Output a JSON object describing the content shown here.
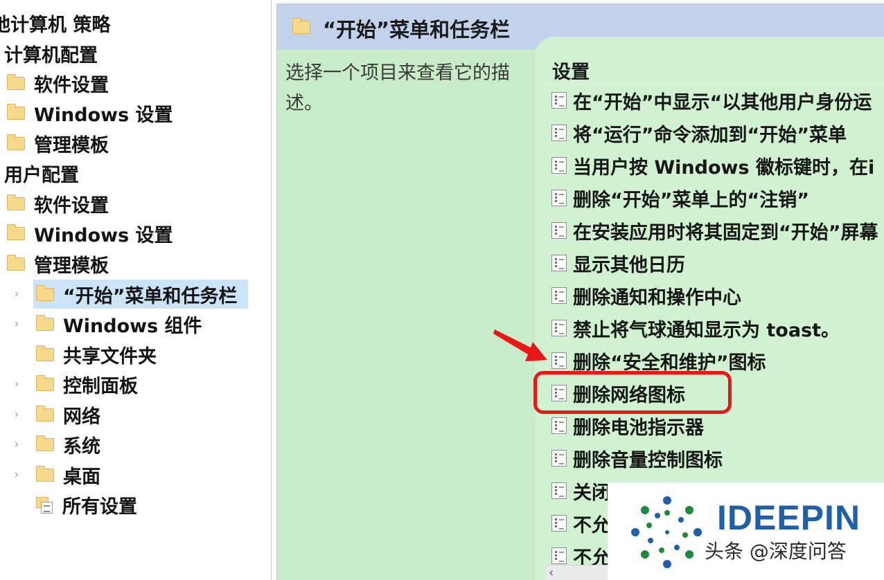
{
  "tree": {
    "items": [
      {
        "label": "地计算机 策略",
        "icon": "none",
        "expander": ""
      },
      {
        "label": "计算机配置",
        "icon": "none",
        "expander": ""
      },
      {
        "label": "软件设置",
        "icon": "folder-icon",
        "expander": ""
      },
      {
        "label": "Windows 设置",
        "icon": "folder-icon",
        "expander": ""
      },
      {
        "label": "管理模板",
        "icon": "folder-icon",
        "expander": ""
      },
      {
        "label": "用户配置",
        "icon": "none",
        "expander": ""
      },
      {
        "label": "软件设置",
        "icon": "folder-icon",
        "expander": ""
      },
      {
        "label": "Windows 设置",
        "icon": "folder-icon",
        "expander": ""
      },
      {
        "label": "管理模板",
        "icon": "folder-icon",
        "expander": ""
      },
      {
        "label": "“开始”菜单和任务栏",
        "icon": "folder-icon",
        "expander": "›",
        "selected": true
      },
      {
        "label": "Windows 组件",
        "icon": "folder-icon",
        "expander": "›"
      },
      {
        "label": "共享文件夹",
        "icon": "folder-icon",
        "expander": ""
      },
      {
        "label": "控制面板",
        "icon": "folder-icon",
        "expander": "›"
      },
      {
        "label": "网络",
        "icon": "folder-icon",
        "expander": "›"
      },
      {
        "label": "系统",
        "icon": "folder-icon",
        "expander": "›"
      },
      {
        "label": "桌面",
        "icon": "folder-icon",
        "expander": "›"
      },
      {
        "label": "所有设置",
        "icon": "all-settings-icon",
        "expander": ""
      }
    ]
  },
  "header": {
    "title": "“开始”菜单和任务栏",
    "icon": "folder-icon"
  },
  "description": {
    "text": "选择一个项目来查看它的描述。"
  },
  "settings": {
    "column_header": "设置",
    "items": [
      "在“开始”中显示“以其他用户身份运",
      "将“运行”命令添加到“开始”菜单",
      "当用户按 Windows 徽标键时，在i",
      "删除“开始”菜单上的“注销”",
      "在安装应用时将其固定到“开始”屏幕",
      "显示其他日历",
      "删除通知和操作中心",
      "禁止将气球通知显示为 toast。",
      "删除“安全和维护”图标",
      "删除网络图标",
      "删除电池指示器",
      "删除音量控制图标",
      "关闭",
      "不允",
      "不允"
    ],
    "highlighted": "删除网络图标"
  },
  "scrollbar": {
    "left_arrow": "‹"
  },
  "watermark": {
    "brand": "IDEEPIN",
    "credit": "头条 @深度问答"
  },
  "colors": {
    "highlight": "#e81818",
    "pane_bg": "#c8ecc8",
    "header_bg": "#c1d2ea",
    "selection": "#cce4f7",
    "brand": "#1f5fa8"
  }
}
